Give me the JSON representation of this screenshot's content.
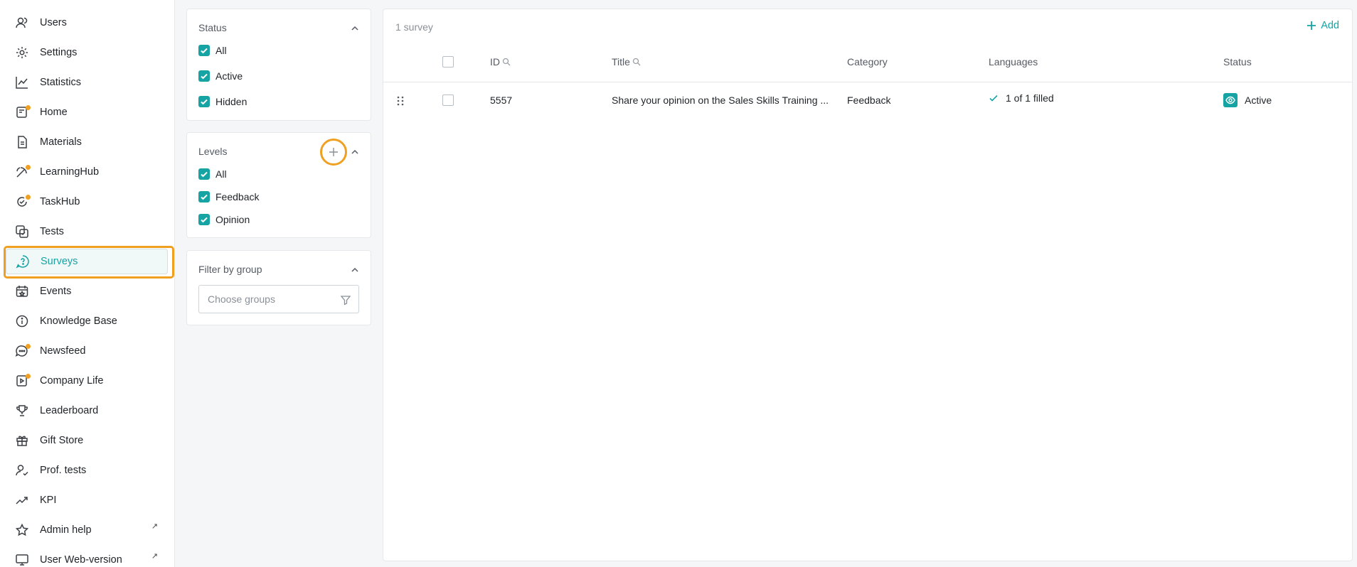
{
  "sidebar": {
    "items": [
      {
        "label": "Users",
        "icon": "users-icon"
      },
      {
        "label": "Settings",
        "icon": "gear-icon"
      },
      {
        "label": "Statistics",
        "icon": "chart-line-icon"
      },
      {
        "label": "Home",
        "icon": "home-icon"
      },
      {
        "label": "Materials",
        "icon": "document-icon"
      },
      {
        "label": "LearningHub",
        "icon": "learninghub-icon"
      },
      {
        "label": "TaskHub",
        "icon": "taskhub-icon"
      },
      {
        "label": "Tests",
        "icon": "tests-icon"
      },
      {
        "label": "Surveys",
        "icon": "survey-icon"
      },
      {
        "label": "Events",
        "icon": "calendar-icon"
      },
      {
        "label": "Knowledge Base",
        "icon": "info-icon"
      },
      {
        "label": "Newsfeed",
        "icon": "chat-icon"
      },
      {
        "label": "Company Life",
        "icon": "video-icon"
      },
      {
        "label": "Leaderboard",
        "icon": "trophy-icon"
      },
      {
        "label": "Gift Store",
        "icon": "gift-icon"
      },
      {
        "label": "Prof. tests",
        "icon": "user-check-icon"
      },
      {
        "label": "KPI",
        "icon": "trend-icon"
      },
      {
        "label": "Admin help",
        "icon": "star-icon",
        "external": "↗"
      },
      {
        "label": "User Web-version",
        "icon": "monitor-icon",
        "external": "↗"
      }
    ],
    "active_item": "Surveys"
  },
  "filters": {
    "status": {
      "title": "Status",
      "options": [
        "All",
        "Active",
        "Hidden"
      ]
    },
    "levels": {
      "title": "Levels",
      "options": [
        "All",
        "Feedback",
        "Opinion"
      ]
    },
    "group": {
      "title": "Filter by group",
      "placeholder": "Choose groups"
    }
  },
  "table": {
    "count_label": "1 survey",
    "add_label": "Add",
    "columns": {
      "id": "ID",
      "title": "Title",
      "category": "Category",
      "languages": "Languages",
      "status": "Status"
    },
    "rows": [
      {
        "id": "5557",
        "title": "Share your opinion on the Sales Skills Training ...",
        "category": "Feedback",
        "languages": "1 of 1 filled",
        "status": "Active"
      }
    ]
  },
  "colors": {
    "accent": "#15a3a3",
    "highlight": "#f0a020"
  }
}
